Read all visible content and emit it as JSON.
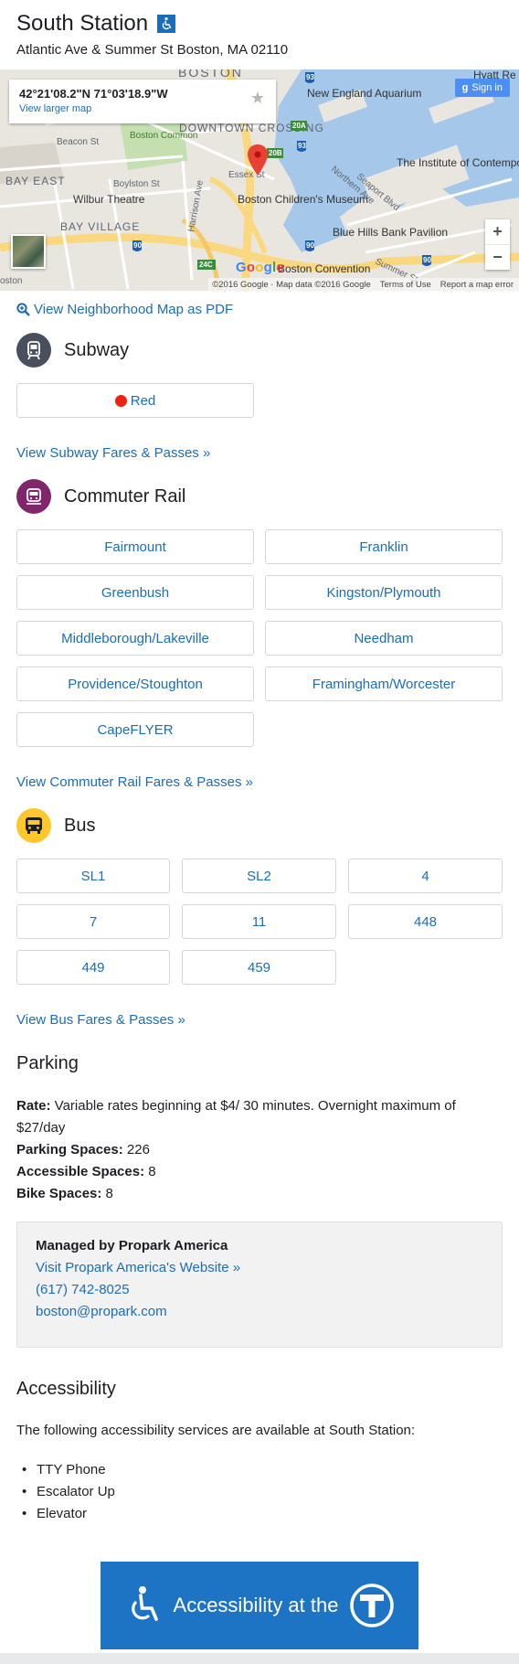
{
  "station": {
    "name": "South Station",
    "address": "Atlantic Ave & Summer St Boston, MA 02110"
  },
  "map": {
    "coords": "42°21'08.2\"N 71°03'18.9\"W",
    "larger_map": "View larger map",
    "signin": "Sign in",
    "labels": {
      "boston": "BOSTON",
      "beacon_st": "Beacon St",
      "boston_common": "Boston Common",
      "downtown_crossing": "DOWNTOWN CROSSING",
      "bay_east": "BAY EAST",
      "boylston_st": "Boylston St",
      "wilbur_theatre": "Wilbur Theatre",
      "bay_village": "BAY VILLAGE",
      "essex_st": "Essex St",
      "harrison_ave": "Harrison Ave",
      "childrens_museum": "Boston Children's Museum",
      "aquarium": "New England Aquarium",
      "hyatt": "Hyatt Re",
      "institute": "The Institute of Contemporary Art/Bost",
      "northern_ave": "Northern Ave",
      "seaport_blvd": "Seaport Blvd",
      "blue_hills": "Blue Hills Bank Pavilion",
      "convention": "Boston Convention",
      "summer_st": "Summer St",
      "oston": "oston"
    },
    "shields": {
      "i93a": "93",
      "i93b": "93",
      "i90a": "90",
      "i90b": "90",
      "i90c": "90",
      "exit20a": "20A",
      "exit20b": "20B",
      "exit24c": "24C"
    },
    "google_letters": [
      "G",
      "o",
      "o",
      "g",
      "l",
      "e"
    ],
    "footer": {
      "copyright": "©2016 Google · Map data ©2016 Google",
      "terms": "Terms of Use",
      "report": "Report a map error"
    },
    "zoom_in": "+",
    "zoom_out": "−"
  },
  "links": {
    "pdf": "View Neighborhood Map as PDF",
    "subway_fares": "View Subway Fares & Passes »",
    "cr_fares": "View Commuter Rail Fares & Passes »",
    "bus_fares": "View Bus Fares & Passes »"
  },
  "subway": {
    "title": "Subway",
    "routes": [
      "Red"
    ]
  },
  "commuter_rail": {
    "title": "Commuter Rail",
    "routes": [
      "Fairmount",
      "Franklin",
      "Greenbush",
      "Kingston/Plymouth",
      "Middleborough/Lakeville",
      "Needham",
      "Providence/Stoughton",
      "Framingham/Worcester",
      "CapeFLYER"
    ]
  },
  "bus": {
    "title": "Bus",
    "routes": [
      "SL1",
      "SL2",
      "4",
      "7",
      "11",
      "448",
      "449",
      "459"
    ]
  },
  "parking": {
    "title": "Parking",
    "rate_label": "Rate:",
    "rate_line1": " Variable rates beginning at $4/ 30 minutes. Overnight maximum of",
    "rate_line2": "$27/day",
    "spaces_label": "Parking Spaces:",
    "spaces": " 226",
    "accessible_label": "Accessible Spaces:",
    "accessible": " 8",
    "bike_label": "Bike Spaces:",
    "bike": " 8",
    "managed_by": "Managed by Propark America",
    "website": "Visit Propark America's Website »",
    "phone": "(617) 742-8025",
    "email": "boston@propark.com"
  },
  "accessibility": {
    "title": "Accessibility",
    "intro": "The following accessibility services are available at South Station:",
    "items": [
      "TTY Phone",
      "Escalator Up",
      "Elevator"
    ],
    "banner": "Accessibility at the"
  },
  "colors": {
    "link": "#1a6db6",
    "subway_icon": "#494f5c",
    "commuter_rail_icon": "#80276c",
    "bus_icon": "#ffc72c",
    "red_line": "#ee2211",
    "banner": "#1d74c4"
  }
}
